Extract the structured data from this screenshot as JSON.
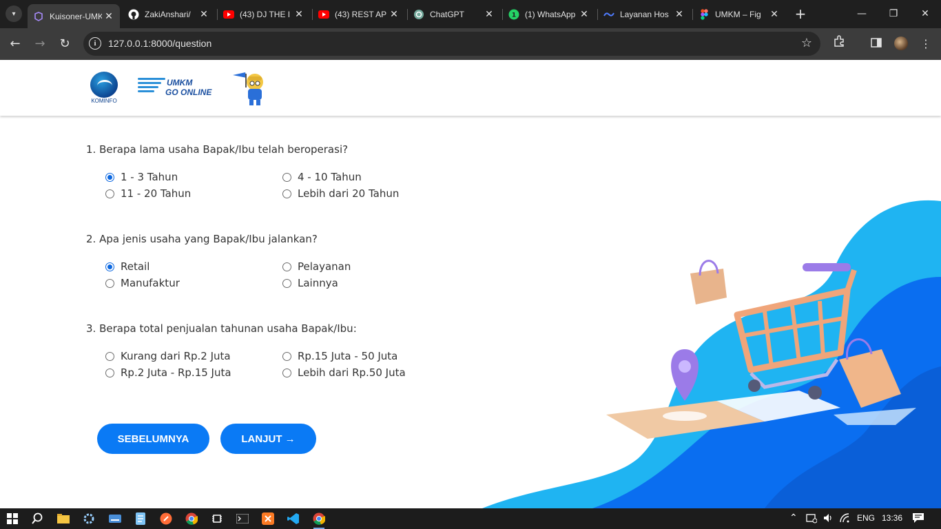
{
  "browser": {
    "tabs": [
      {
        "title": "Kuisoner-UMKM",
        "favicon": "laravel-icon",
        "active": true
      },
      {
        "title": "ZakiAnshari/",
        "favicon": "github-icon",
        "active": false
      },
      {
        "title": "(43) DJ THE I",
        "favicon": "youtube-icon",
        "active": false
      },
      {
        "title": "(43) REST AP",
        "favicon": "youtube-icon",
        "active": false
      },
      {
        "title": "ChatGPT",
        "favicon": "chatgpt-icon",
        "active": false
      },
      {
        "title": "(1) WhatsApp",
        "favicon": "whatsapp-icon",
        "active": false
      },
      {
        "title": "Layanan Hos",
        "favicon": "hosting-icon",
        "active": false
      },
      {
        "title": "UMKM – Fig",
        "favicon": "figma-icon",
        "active": false
      }
    ],
    "close_glyph": "✕",
    "new_tab_glyph": "+",
    "url": "127.0.0.1:8000/question"
  },
  "header": {
    "kominfo_text": "KOMINFO",
    "umkm_line1": "UMKM",
    "umkm_line2": "GO ONLINE"
  },
  "questions": [
    {
      "title": "1. Berapa lama usaha Bapak/Ibu telah beroperasi?",
      "options": [
        "1 - 3 Tahun",
        "4 - 10 Tahun",
        "11 - 20 Tahun",
        "Lebih dari 20 Tahun"
      ],
      "selected": 0
    },
    {
      "title": "2. Apa jenis usaha yang Bapak/Ibu jalankan?",
      "options": [
        "Retail",
        "Pelayanan",
        "Manufaktur",
        "Lainnya"
      ],
      "selected": 0
    },
    {
      "title": "3. Berapa total penjualan tahunan usaha Bapak/Ibu:",
      "options": [
        "Kurang dari Rp.2 Juta",
        "Rp.15 Juta - 50 Juta",
        "Rp.2 Juta - Rp.15 Juta",
        "Lebih dari Rp.50 Juta"
      ],
      "selected": null
    }
  ],
  "buttons": {
    "prev": "SEBELUMNYA",
    "next": "LANJUT →"
  },
  "colors": {
    "accent": "#0a7af5",
    "radio_checked": "#0b67e0",
    "wave_light": "#1fb4f2",
    "wave_dark": "#0a6ef0"
  },
  "taskbar": {
    "language": "ENG",
    "time": "13:36"
  }
}
